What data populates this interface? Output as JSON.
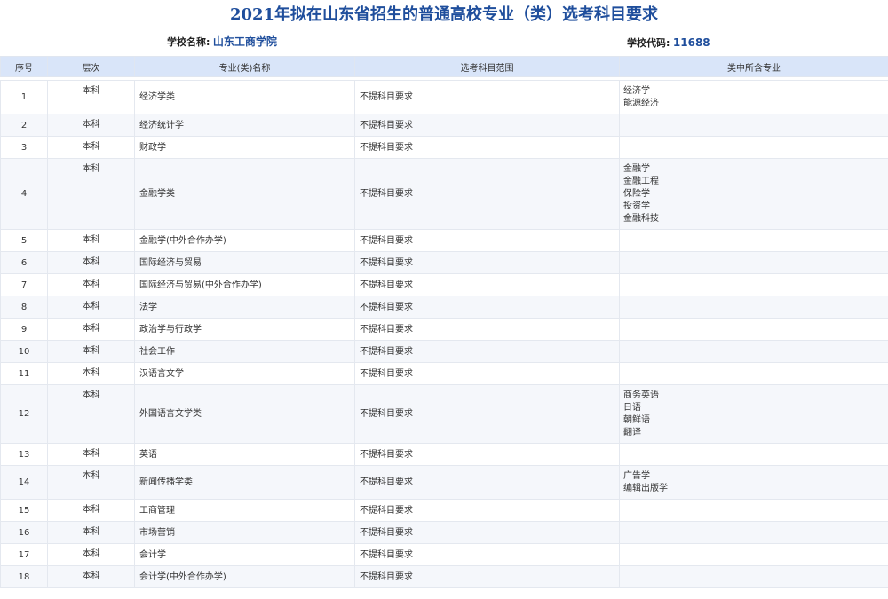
{
  "title": "2021年拟在山东省招生的普通高校专业（类）选考科目要求",
  "school": {
    "name_label": "学校名称:",
    "name": "山东工商学院",
    "code_label": "学校代码:",
    "code": "11688"
  },
  "columns": [
    "序号",
    "层次",
    "专业(类)名称",
    "选考科目范围",
    "类中所含专业"
  ],
  "rows": [
    {
      "no": "1",
      "level": "本科",
      "name": "经济学类",
      "req": "不提科目要求",
      "subs": [
        "经济学",
        "能源经济"
      ]
    },
    {
      "no": "2",
      "level": "本科",
      "name": "经济统计学",
      "req": "不提科目要求",
      "subs": []
    },
    {
      "no": "3",
      "level": "本科",
      "name": "财政学",
      "req": "不提科目要求",
      "subs": []
    },
    {
      "no": "4",
      "level": "本科",
      "name": "金融学类",
      "req": "不提科目要求",
      "subs": [
        "金融学",
        "金融工程",
        "保险学",
        "投资学",
        "金融科技"
      ]
    },
    {
      "no": "5",
      "level": "本科",
      "name": "金融学(中外合作办学)",
      "req": "不提科目要求",
      "subs": []
    },
    {
      "no": "6",
      "level": "本科",
      "name": "国际经济与贸易",
      "req": "不提科目要求",
      "subs": []
    },
    {
      "no": "7",
      "level": "本科",
      "name": "国际经济与贸易(中外合作办学)",
      "req": "不提科目要求",
      "subs": []
    },
    {
      "no": "8",
      "level": "本科",
      "name": "法学",
      "req": "不提科目要求",
      "subs": []
    },
    {
      "no": "9",
      "level": "本科",
      "name": "政治学与行政学",
      "req": "不提科目要求",
      "subs": []
    },
    {
      "no": "10",
      "level": "本科",
      "name": "社会工作",
      "req": "不提科目要求",
      "subs": []
    },
    {
      "no": "11",
      "level": "本科",
      "name": "汉语言文学",
      "req": "不提科目要求",
      "subs": []
    },
    {
      "no": "12",
      "level": "本科",
      "name": "外国语言文学类",
      "req": "不提科目要求",
      "subs": [
        "商务英语",
        "日语",
        "朝鲜语",
        "翻译"
      ]
    },
    {
      "no": "13",
      "level": "本科",
      "name": "英语",
      "req": "不提科目要求",
      "subs": []
    },
    {
      "no": "14",
      "level": "本科",
      "name": "新闻传播学类",
      "req": "不提科目要求",
      "subs": [
        "广告学",
        "编辑出版学"
      ]
    },
    {
      "no": "15",
      "level": "本科",
      "name": "工商管理",
      "req": "不提科目要求",
      "subs": []
    },
    {
      "no": "16",
      "level": "本科",
      "name": "市场营销",
      "req": "不提科目要求",
      "subs": []
    },
    {
      "no": "17",
      "level": "本科",
      "name": "会计学",
      "req": "不提科目要求",
      "subs": []
    },
    {
      "no": "18",
      "level": "本科",
      "name": "会计学(中外合作办学)",
      "req": "不提科目要求",
      "subs": []
    }
  ]
}
